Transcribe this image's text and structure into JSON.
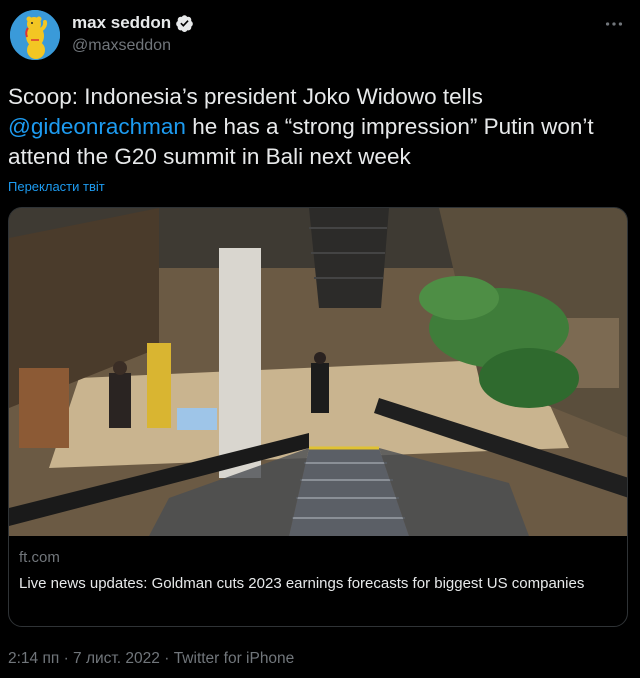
{
  "author": {
    "display_name": "max seddon",
    "handle": "@maxseddon"
  },
  "tweet": {
    "text_part1": "Scoop: Indonesia’s president Joko Widowo tells ",
    "mention": "@gideonrachman",
    "text_part2": " he has a “strong impression” Putin won’t attend the G20 summit in Bali next week",
    "translate_label": "Перекласти твіт"
  },
  "card": {
    "domain": "ft.com",
    "title": "Live news updates: Goldman cuts 2023 earnings forecasts for biggest US companies"
  },
  "meta": {
    "time": "2:14 пп",
    "date": "7 лист. 2022",
    "source": "Twitter for iPhone",
    "separator": " · "
  },
  "icons": {
    "avatar": "bear-avatar",
    "verified": "verified-badge-icon",
    "more": "more-options-icon"
  },
  "colors": {
    "background": "#000000",
    "text": "#e7e9ea",
    "secondary": "#71767b",
    "accent": "#1d9bf0",
    "border": "#2f3336"
  }
}
